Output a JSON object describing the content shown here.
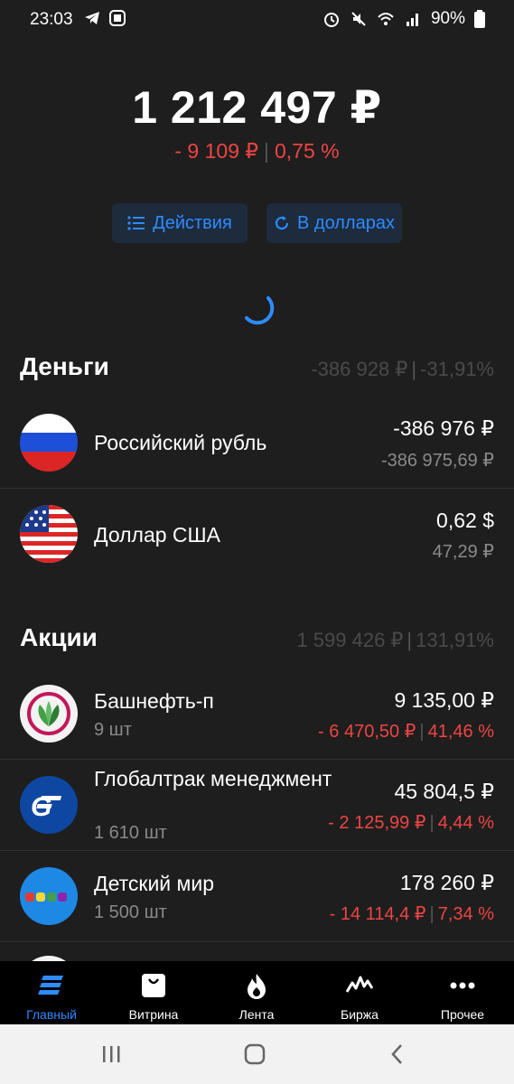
{
  "status_bar": {
    "time": "23:03",
    "battery": "90%"
  },
  "portfolio": {
    "total": "1 212 497 ₽",
    "change_abs": "- 9 109 ₽",
    "change_pct": "0,75 %",
    "actions_label": "Действия",
    "currency_label": "В долларах"
  },
  "money": {
    "title": "Деньги",
    "sum_abs": "-386 928 ₽",
    "sum_pct": "-31,91%",
    "items": [
      {
        "name": "Российский рубль",
        "value": "-386 976 ₽",
        "value_sub": "-386 975,69 ₽"
      },
      {
        "name": "Доллар США",
        "value": "0,62 $",
        "value_sub": "47,29 ₽"
      }
    ]
  },
  "stocks": {
    "title": "Акции",
    "sum_abs": "1 599 426 ₽",
    "sum_pct": "131,91%",
    "items": [
      {
        "name": "Башнефть-п",
        "qty": "9 шт",
        "value": "9 135,00 ₽",
        "change_abs": "- 6 470,50 ₽",
        "change_pct": "41,46 %"
      },
      {
        "name": "Глобалтрак менеджмент",
        "qty": "1 610 шт",
        "value": "45 804,5 ₽",
        "change_abs": "- 2 125,99 ₽",
        "change_pct": "4,44 %"
      },
      {
        "name": "Детский мир",
        "qty": "1 500 шт",
        "value": "178 260 ₽",
        "change_abs": "- 14 114,4 ₽",
        "change_pct": "7,34 %"
      }
    ]
  },
  "bottom_nav": [
    {
      "label": "Главный",
      "icon": "home-stripes-icon",
      "active": true
    },
    {
      "label": "Витрина",
      "icon": "shopping-bag-icon",
      "active": false
    },
    {
      "label": "Лента",
      "icon": "flame-icon",
      "active": false
    },
    {
      "label": "Биржа",
      "icon": "pulse-chart-icon",
      "active": false
    },
    {
      "label": "Прочее",
      "icon": "more-dots-icon",
      "active": false
    }
  ],
  "colors": {
    "background": "#1e1e1e",
    "accent": "#2e8bff",
    "negative": "#ef4444",
    "muted": "#8a8a8a"
  }
}
